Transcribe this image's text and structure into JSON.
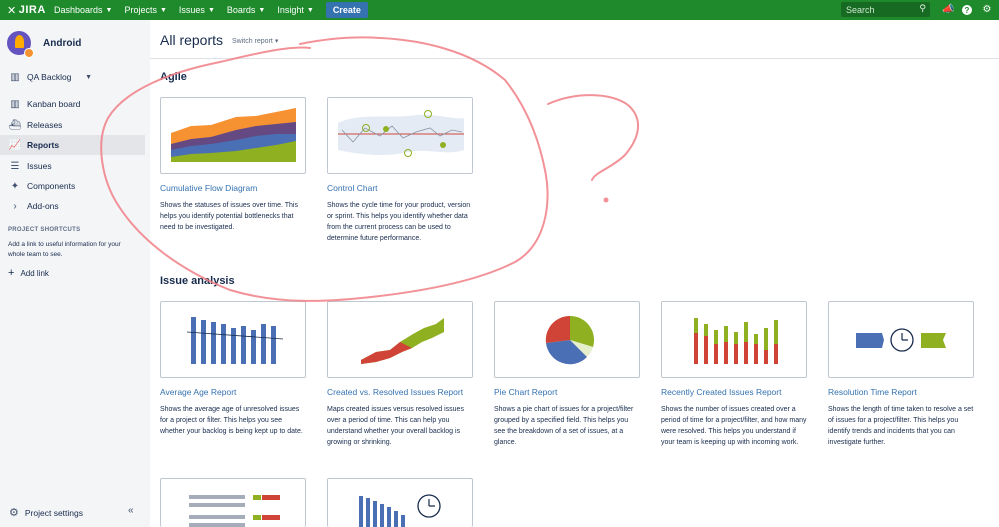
{
  "topbar": {
    "logo_text": "JIRA",
    "nav": [
      {
        "label": "Dashboards"
      },
      {
        "label": "Projects"
      },
      {
        "label": "Issues"
      },
      {
        "label": "Boards"
      },
      {
        "label": "Insight"
      }
    ],
    "create_label": "Create",
    "search_placeholder": "Search",
    "icons": [
      "search-icon",
      "feedback-icon",
      "help-icon",
      "settings-icon"
    ],
    "bg_color": "#1e8a2b"
  },
  "sidebar": {
    "project_name": "Android",
    "board_label": "QA Backlog",
    "items": [
      {
        "label": "Kanban board",
        "icon": "board-icon"
      },
      {
        "label": "Releases",
        "icon": "ship-icon"
      },
      {
        "label": "Reports",
        "icon": "chart-icon"
      },
      {
        "label": "Issues",
        "icon": "issues-icon"
      },
      {
        "label": "Components",
        "icon": "puzzle-icon"
      },
      {
        "label": "Add-ons",
        "icon": "chevron-right-icon"
      }
    ],
    "shortcuts_heading": "PROJECT SHORTCUTS",
    "shortcuts_help": "Add a link to useful information for your whole team to see.",
    "add_link": "Add link",
    "settings_label": "Project settings"
  },
  "main": {
    "title": "All reports",
    "switch_label": "Switch report",
    "sections": [
      {
        "title": "Agile",
        "cards": [
          {
            "title": "Cumulative Flow Diagram",
            "desc": "Shows the statuses of issues over time. This helps you identify potential bottlenecks that need to be investigated."
          },
          {
            "title": "Control Chart",
            "desc": "Shows the cycle time for your product, version or sprint. This helps you identify whether data from the current process can be used to determine future performance."
          }
        ]
      },
      {
        "title": "Issue analysis",
        "cards": [
          {
            "title": "Average Age Report",
            "desc": "Shows the average age of unresolved issues for a project or filter. This helps you see whether your backlog is being kept up to date."
          },
          {
            "title": "Created vs. Resolved Issues Report",
            "desc": "Maps created issues versus resolved issues over a period of time. This can help you understand whether your overall backlog is growing or shrinking."
          },
          {
            "title": "Pie Chart Report",
            "desc": "Shows a pie chart of issues for a project/filter grouped by a specified field. This helps you see the breakdown of a set of issues, at a glance."
          },
          {
            "title": "Recently Created Issues Report",
            "desc": "Shows the number of issues created over a period of time for a project/filter, and how many were resolved. This helps you understand if your team is keeping up with incoming work."
          },
          {
            "title": "Resolution Time Report",
            "desc": "Shows the length of time taken to resolve a set of issues for a project/filter. This helps you identify trends and incidents that you can investigate further."
          }
        ]
      }
    ]
  },
  "colors": {
    "link": "#3572b0",
    "annotation": "#f07f86",
    "orange": "#f79232",
    "purple": "#654982",
    "blue": "#4a6fb5",
    "green": "#8eb021",
    "red": "#d04437"
  }
}
